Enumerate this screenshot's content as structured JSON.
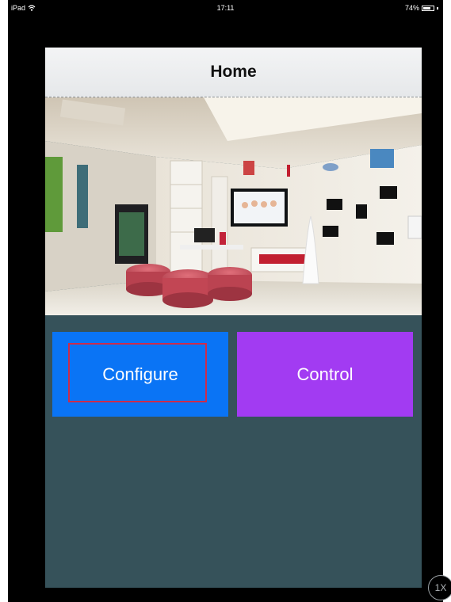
{
  "status_bar": {
    "device": "iPad",
    "time": "17:11",
    "battery": "74%",
    "battery_level": 0.74,
    "wifi_icon": "wifi-icon",
    "battery_icon": "battery-icon"
  },
  "nav": {
    "title": "Home"
  },
  "hero": {
    "tv_icon": "tv-icon"
  },
  "buttons": {
    "configure_label": "Configure",
    "control_label": "Control"
  },
  "overlay": {
    "speed_label": "1X"
  },
  "colors": {
    "background": "#36525a",
    "configure": "#0a74f5",
    "control": "#a23bf2",
    "focus_ring": "#cc2c4c"
  }
}
